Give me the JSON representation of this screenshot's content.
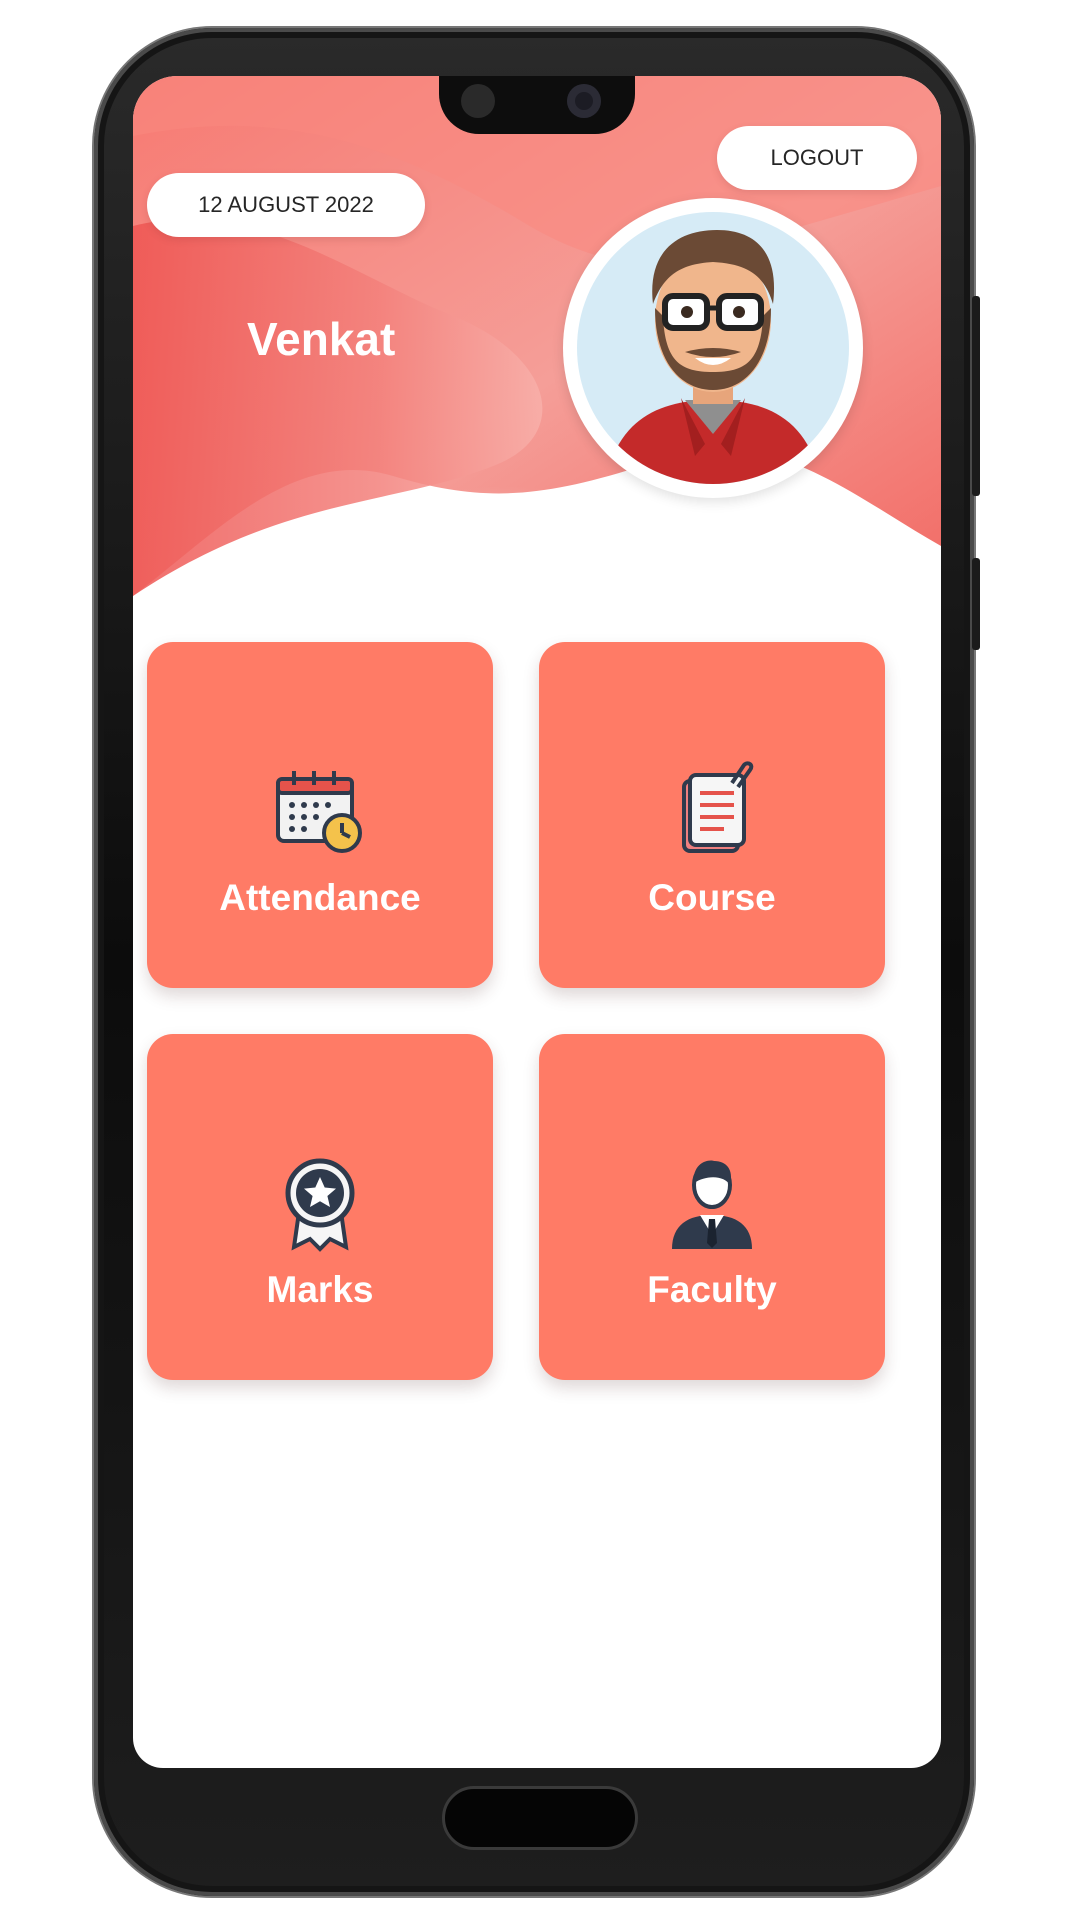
{
  "header": {
    "date": "12 AUGUST 2022",
    "logout_label": "LOGOUT",
    "user_name": "Venkat"
  },
  "tiles": [
    {
      "label": "Attendance",
      "icon": "calendar-clock-icon"
    },
    {
      "label": "Course",
      "icon": "document-clip-icon"
    },
    {
      "label": "Marks",
      "icon": "award-badge-icon"
    },
    {
      "label": "Faculty",
      "icon": "person-suit-icon"
    }
  ],
  "colors": {
    "accent": "#ff7b66",
    "header_gradient": [
      "#f15a57",
      "#fa9a93"
    ],
    "tile_text": "#ffffff",
    "icon_dark": "#2f3a4c"
  }
}
